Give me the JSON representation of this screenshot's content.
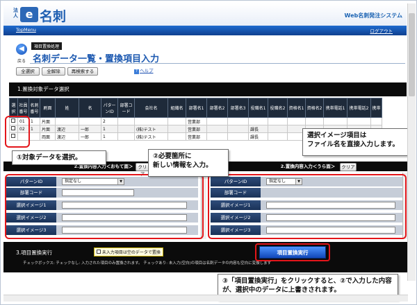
{
  "header": {
    "logo_small": "法人",
    "logo_letter": "e",
    "logo_text": "名刺",
    "system_title": "Web名刺発注システム"
  },
  "nav": {
    "top_menu": "TopMenu",
    "logout": "ログアウト"
  },
  "page": {
    "back_label": "戻る",
    "breadcrumb": "項目置換処理",
    "title": "名刺データ一覧・置換項目入力"
  },
  "toolbar": {
    "select_all": "全選択",
    "deselect_all": "全解除",
    "research": "再検索する",
    "help": "ヘルプ"
  },
  "section1": {
    "title": "1.置換対象データ選択"
  },
  "table": {
    "headers": [
      "選択",
      "社員番号",
      "名刺番号",
      "刷面",
      "姓",
      "名",
      "パターンID",
      "部署コード",
      "会社名",
      "組織名",
      "部署名1",
      "部署名2",
      "部署名3",
      "役職名1",
      "役職名2",
      "資格名1",
      "資格名2",
      "携帯電話1",
      "携帯電話2",
      "携帯"
    ],
    "rows": [
      [
        "",
        "01",
        "1",
        "片面",
        "",
        "",
        "2",
        "",
        "",
        "",
        "営業部",
        "",
        "",
        "",
        "",
        "",
        "",
        "",
        "",
        ""
      ],
      [
        "",
        "02",
        "1",
        "片面",
        "渡辺",
        "一郎",
        "1",
        "",
        "(株)テスト",
        "",
        "営業部",
        "",
        "",
        "課長",
        "",
        "",
        "",
        "",
        "",
        ""
      ],
      [
        "",
        "",
        "",
        "両面",
        "渡辺",
        "一郎",
        "1",
        "",
        "(株)テスト",
        "",
        "営業部",
        "",
        "",
        "課長",
        "",
        "",
        "",
        "",
        "",
        ""
      ]
    ]
  },
  "panel_front": {
    "title": "2.置換内容入力＜おもて面＞",
    "clear": "クリア",
    "pattern_label": "パターンID",
    "pattern_value": "指定なし",
    "dept_code_label": "部署コード",
    "image1_label": "選択イメージ1",
    "image2_label": "選択イメージ2",
    "image3_label": "選択イメージ3"
  },
  "panel_back": {
    "title": "2.置換内容入力＜うら面＞",
    "clear": "クリア",
    "pattern_label": "パターンID",
    "pattern_value": "指定なし",
    "dept_code_label": "部署コード",
    "image1_label": "選択イメージ1",
    "image2_label": "選択イメージ2",
    "image3_label": "選択イメージ3"
  },
  "section3": {
    "title": "3.項目置換実行",
    "empty_checkbox_label": "未入力項目は空のデータで置換",
    "note": "チェックボックス: チェックなし: 入力された項目のみ置換されます。 チェックあり: 未入力(空白)の項目は名刺データの内容も空白に変換します",
    "exec_button": "項目置換実行"
  },
  "callouts": {
    "c1": "①対象データを選択。",
    "c2_line1": "②必要箇所に",
    "c2_line2": "新しい情報を入力。",
    "c_image_line1": "選択イメージ項目は",
    "c_image_line2": "ファイル名を直接入力します。",
    "c3_line1": "③「項目置換実行」をクリックすると、②で入力した内容",
    "c3_line2": "が、選択中のデータに上書きされます。"
  },
  "colors": {
    "accent": "#1b58b0",
    "highlight": "#e3151a",
    "header_dark": "#0b0b0b"
  }
}
